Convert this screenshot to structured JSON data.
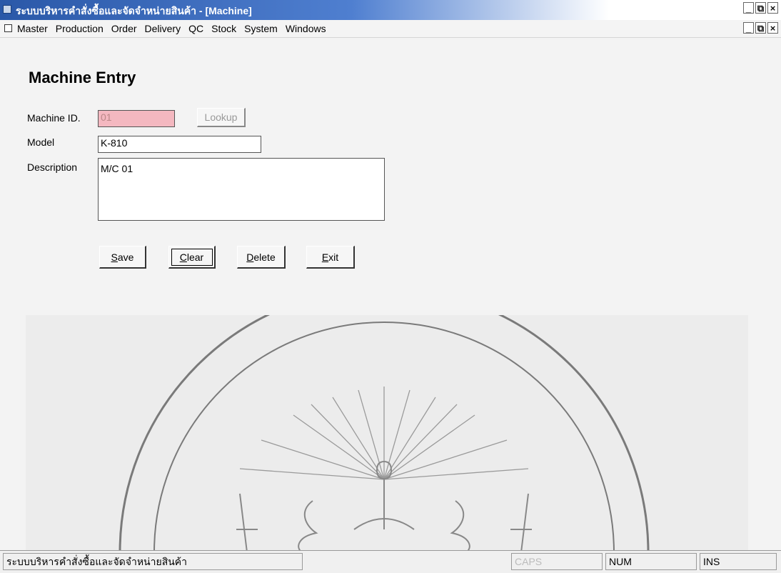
{
  "window": {
    "title": "ระบบบริหารคำสั่งซื้อและจัดจำหน่ายสินค้า - [Machine]",
    "controls": {
      "minimize": "_",
      "restore": "⧉",
      "close": "×"
    }
  },
  "menu": {
    "items": [
      "Master",
      "Production",
      "Order",
      "Delivery",
      "QC",
      "Stock",
      "System",
      "Windows"
    ]
  },
  "form": {
    "heading": "Machine Entry",
    "machine_id_label": "Machine ID.",
    "machine_id_value": "01",
    "lookup_label": "Lookup",
    "model_label": "Model",
    "model_value": "K-810",
    "description_label": "Description",
    "description_value": "M/C 01"
  },
  "buttons": {
    "save": {
      "key": "S",
      "rest": "ave"
    },
    "clear": {
      "key": "C",
      "rest": "lear"
    },
    "delete": {
      "key": "D",
      "rest": "elete"
    },
    "exit": {
      "key": "E",
      "rest": "xit"
    }
  },
  "statusbar": {
    "app_name": "ระบบบริหารคำสั่งซื้อและจัดจำหน่ายสินค้า",
    "caps": "CAPS",
    "num": "NUM",
    "ins": "INS"
  },
  "colors": {
    "title_gradient_start": "#2a58a8",
    "disabled_field": "#f4b8c0"
  }
}
